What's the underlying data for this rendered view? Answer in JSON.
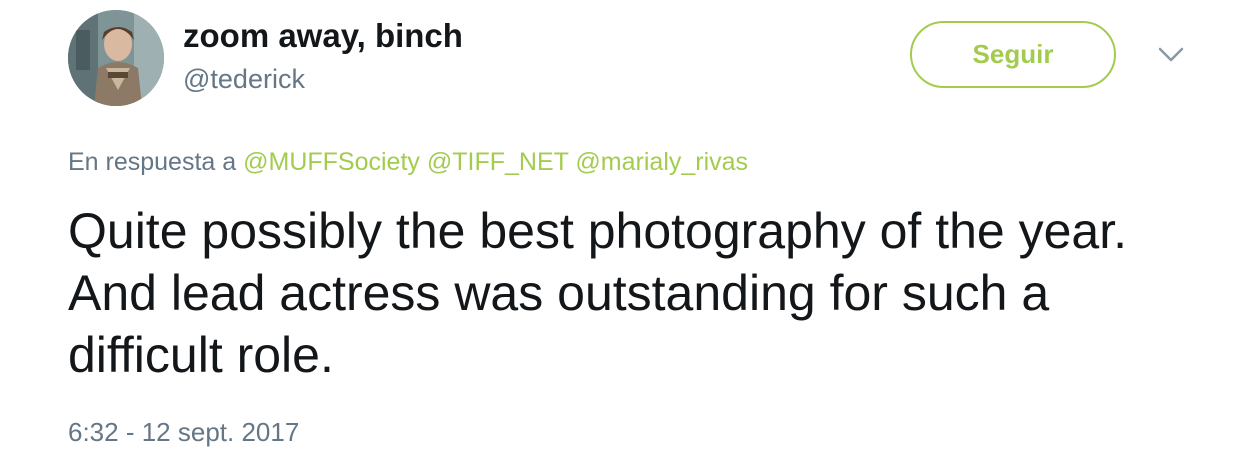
{
  "user": {
    "display_name": "zoom away, binch",
    "handle": "@tederick"
  },
  "follow_button": {
    "label": "Seguir"
  },
  "reply_context": {
    "prefix": "En respuesta a",
    "mentions": [
      "@MUFFSociety",
      "@TIFF_NET",
      "@marialy_rivas"
    ]
  },
  "tweet": {
    "text": "Quite possibly the best photography of the year. And lead actress was outstanding for such a difficult role.",
    "timestamp": "6:32 - 12 sept. 2017"
  },
  "colors": {
    "accent": "#a3cc4f",
    "secondary_text": "#657786",
    "primary_text": "#14171a"
  },
  "icons": {
    "more": "chevron-down-icon",
    "avatar": "avatar"
  }
}
